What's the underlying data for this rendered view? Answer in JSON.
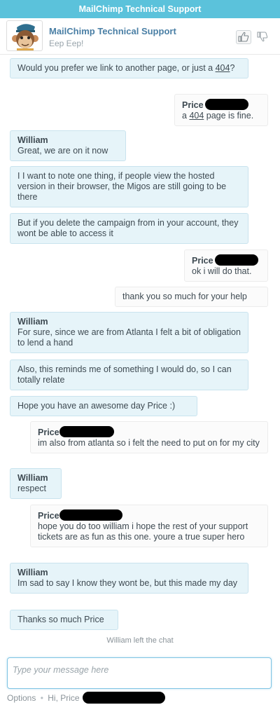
{
  "window": {
    "title": "MailChimp Technical Support"
  },
  "header": {
    "title": "MailChimp Technical Support",
    "subtitle": "Eep Eep!",
    "avatar_icon": "freddie-chimp-avatar",
    "rate_up_icon": "thumbs-up-icon",
    "rate_down_icon": "thumbs-down-icon"
  },
  "messages": [
    {
      "side": "op",
      "name": "",
      "text_before": "Would you prefer we link to another page, or just a ",
      "link": "404",
      "text_after": "?"
    },
    {
      "side": "visitor",
      "name": "Price",
      "text_before": "a ",
      "link": "404",
      "text_after": " page is fine."
    },
    {
      "side": "op",
      "name": "William",
      "text": "Great, we are on it now"
    },
    {
      "side": "op",
      "name": "",
      "text": "I I want to note one thing, if people view the hosted version in their browser, the Migos are still going to be there"
    },
    {
      "side": "op",
      "name": "",
      "text": "But if you delete the campaign from in your account, they wont be able to access it"
    },
    {
      "side": "visitor",
      "name": "Price",
      "text": "ok i will do that."
    },
    {
      "side": "visitor",
      "name": "",
      "text": "thank you so much for your help"
    },
    {
      "side": "op",
      "name": "William",
      "text": "For sure, since we are from Atlanta I felt a bit of obligation to lend a hand"
    },
    {
      "side": "op",
      "name": "",
      "text": "Also, this reminds me of something I would do, so I can totally relate"
    },
    {
      "side": "op",
      "name": "",
      "text": "Hope you have an awesome day Price :)"
    },
    {
      "side": "visitor",
      "name": "Price",
      "text": "im also from atlanta so i felt the need to put on for my city"
    },
    {
      "side": "op",
      "name": "William",
      "text": "respect"
    },
    {
      "side": "visitor",
      "name": "Price",
      "text": "hope you do too william i hope the rest of your support tickets are as fun as this one. youre a true super hero"
    },
    {
      "side": "op",
      "name": "William",
      "text": "Im sad to say I know they wont be, but this made my day"
    },
    {
      "side": "op",
      "name": "",
      "text": "Thanks so much Price"
    }
  ],
  "system_message": "William left the chat",
  "composer": {
    "placeholder": "Type your message here",
    "value": ""
  },
  "footer": {
    "options_label": "Options",
    "separator": "•",
    "greeting": "Hi, Price"
  },
  "colors": {
    "titlebar": "#5bc2db",
    "operator_bubble": "#e6f4f9",
    "visitor_bubble": "#fbfbfb",
    "accent_text": "#4a7fa5"
  }
}
